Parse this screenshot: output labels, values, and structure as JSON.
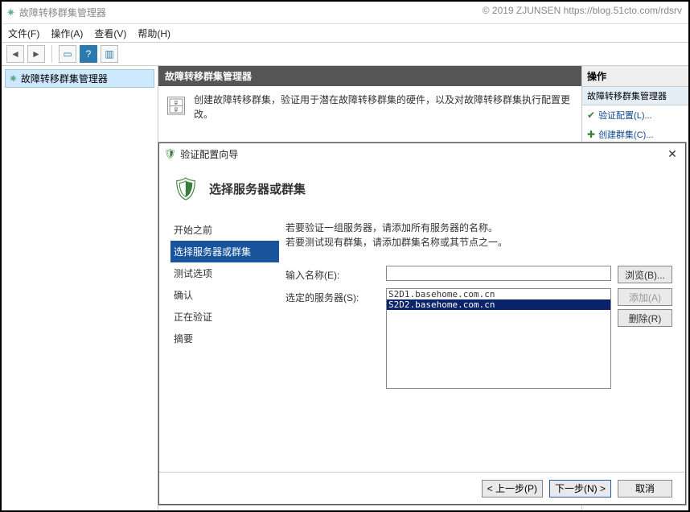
{
  "watermark": "© 2019 ZJUNSEN https://blog.51cto.com/rdsrv",
  "window": {
    "title": "故障转移群集管理器"
  },
  "menu": {
    "file": "文件(F)",
    "action": "操作(A)",
    "view": "查看(V)",
    "help": "帮助(H)"
  },
  "tree": {
    "root": "故障转移群集管理器"
  },
  "center": {
    "title": "故障转移群集管理器",
    "desc": "创建故障转移群集，验证用于潜在故障转移群集的硬件，以及对故障转移群集执行配置更改。"
  },
  "actions": {
    "head": "操作",
    "sub": "故障转移群集管理器",
    "items": [
      "验证配置(L)...",
      "创建群集(C)..."
    ]
  },
  "wizard": {
    "title": "验证配置向导",
    "header": "选择服务器或群集",
    "nav": [
      "开始之前",
      "选择服务器或群集",
      "测试选项",
      "确认",
      "正在验证",
      "摘要"
    ],
    "instr1": "若要验证一组服务器，请添加所有服务器的名称。",
    "instr2": "若要测试现有群集，请添加群集名称或其节点之一。",
    "name_label": "输入名称(E):",
    "selected_label": "选定的服务器(S):",
    "servers": [
      "S2D1.basehome.com.cn",
      "S2D2.basehome.com.cn"
    ],
    "browse": "浏览(B)...",
    "add": "添加(A)",
    "remove": "删除(R)",
    "prev": "< 上一步(P)",
    "next": "下一步(N) >",
    "cancel": "取消"
  }
}
